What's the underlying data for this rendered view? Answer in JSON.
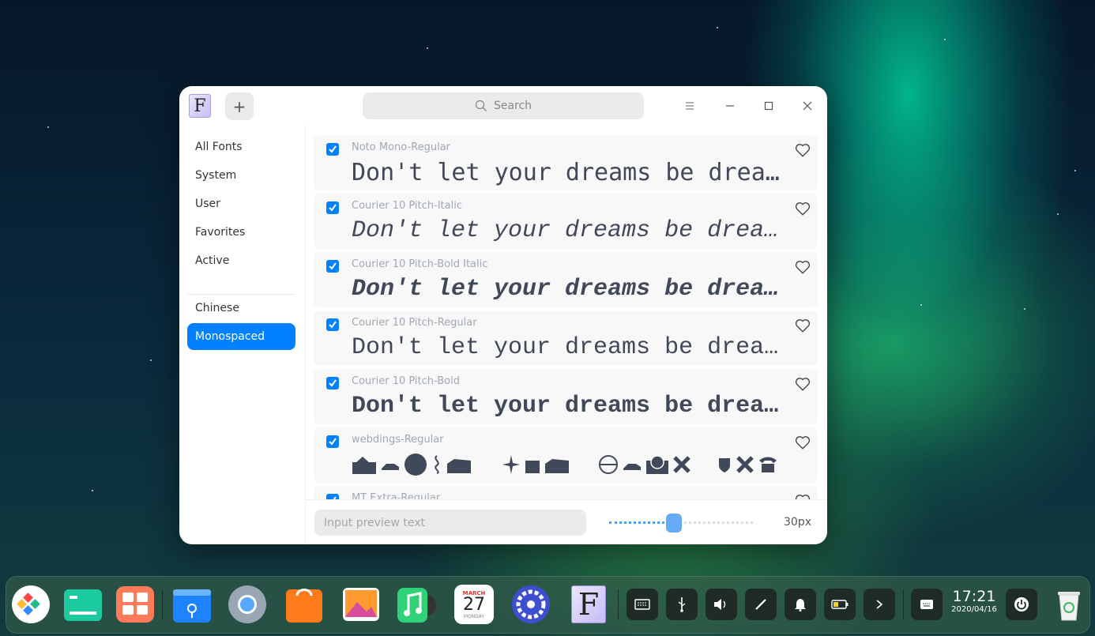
{
  "window": {
    "app_icon_letter": "F",
    "add_symbol": "+",
    "search_placeholder": "Search"
  },
  "sidebar": {
    "items": [
      {
        "label": "All Fonts"
      },
      {
        "label": "System"
      },
      {
        "label": "User"
      },
      {
        "label": "Favorites"
      },
      {
        "label": "Active"
      },
      {
        "label": "Chinese"
      },
      {
        "label": "Monospaced",
        "active": true
      }
    ]
  },
  "fonts": [
    {
      "name": "Noto Mono-Regular",
      "preview": "Don't let your dreams be dreams",
      "checked": true,
      "favorite": false
    },
    {
      "name": "Courier 10 Pitch-Italic",
      "preview": "Don't let your dreams be dreams",
      "checked": true,
      "favorite": false
    },
    {
      "name": "Courier 10 Pitch-Bold Italic",
      "preview": "Don't let your dreams be dreams",
      "checked": true,
      "favorite": false
    },
    {
      "name": "Courier 10 Pitch-Regular",
      "preview": "Don't let your dreams be dreams",
      "checked": true,
      "favorite": false
    },
    {
      "name": "Courier 10 Pitch-Bold",
      "preview": "Don't let your dreams be dreams",
      "checked": true,
      "favorite": false
    },
    {
      "name": "webdings-Regular",
      "checked": true,
      "favorite": false
    },
    {
      "name": "MT Extra-Regular",
      "checked": true,
      "favorite": false
    }
  ],
  "footer": {
    "preview_placeholder": "Input preview text",
    "size_value": 30,
    "size_fraction": 0.45,
    "size_label": "30px"
  },
  "dock": {
    "calendar_month": "MARCH",
    "calendar_day": "27",
    "calendar_weekday": "MONDAY",
    "font_app_letter": "F",
    "clock_time": "17:21",
    "clock_date": "2020/04/16"
  },
  "colors": {
    "accent": "#0081ff",
    "preview_text": "#41485a",
    "font_name_text": "#a0a8b4"
  }
}
